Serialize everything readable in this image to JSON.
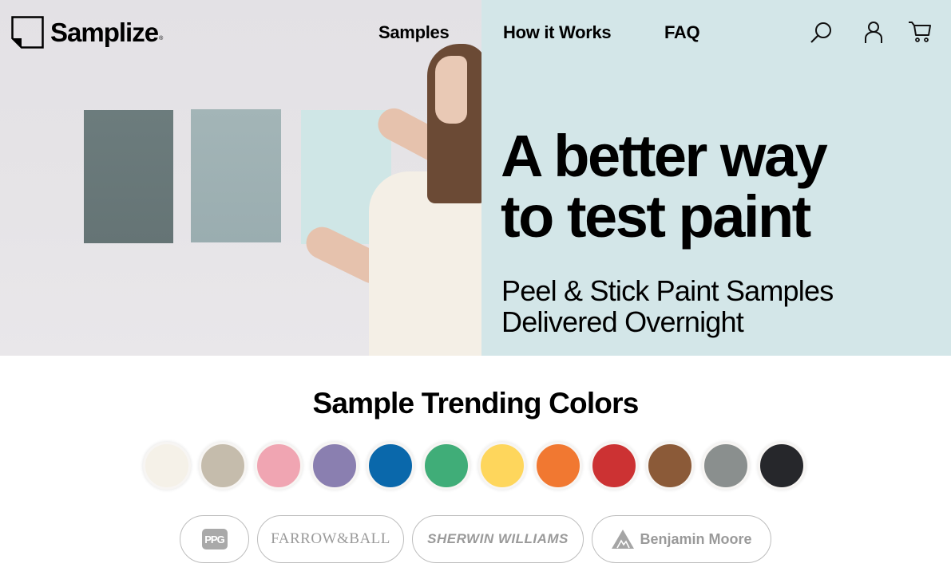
{
  "brand": {
    "name": "Samplize",
    "registered": "®"
  },
  "nav": {
    "links": [
      "Samples",
      "How it Works",
      "FAQ"
    ],
    "icons": [
      "search-icon",
      "account-icon",
      "cart-icon"
    ]
  },
  "hero": {
    "headline_line1": "A better way",
    "headline_line2": "to test paint",
    "subline_line1": "Peel & Stick Paint Samples",
    "subline_line2": "Delivered Overnight",
    "background": "#d3e6e8",
    "wall_swatches": [
      "#6a797a",
      "#9fb1b3",
      "#cfe6e6"
    ]
  },
  "trending": {
    "title": "Sample Trending Colors",
    "colors": [
      "#f5f1e8",
      "#c5bcac",
      "#f0a5b2",
      "#8a7fb0",
      "#0a68ab",
      "#40ad78",
      "#fed65c",
      "#f17831",
      "#cc3233",
      "#8b5a38",
      "#8a8f8e",
      "#26272b"
    ]
  },
  "brands": {
    "ppg": "PPG",
    "farrow_ball": "FARROW&BALL",
    "sherwin_williams": "SHERWIN WILLIAMS",
    "benjamin_moore": "Benjamin Moore"
  }
}
